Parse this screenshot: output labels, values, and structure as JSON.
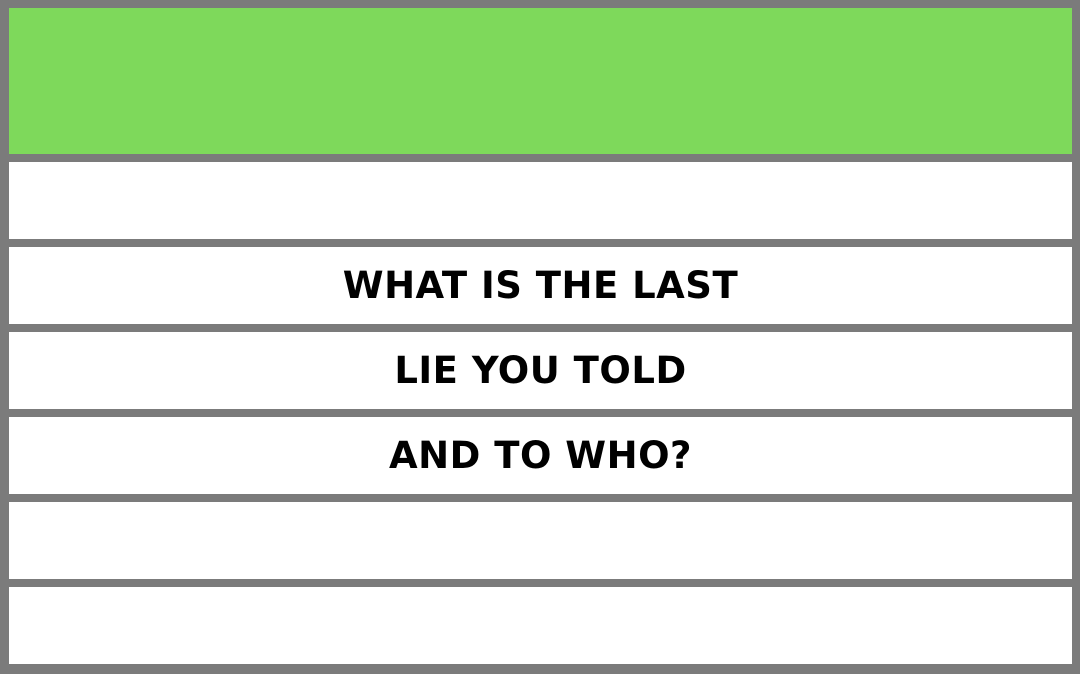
{
  "colors": {
    "frame": "#7b7b7b",
    "header": "#7ed95b",
    "row": "#ffffff",
    "text": "#000000"
  },
  "question": {
    "line1": "WHAT IS THE LAST",
    "line2": "LIE YOU TOLD",
    "line3": "AND TO WHO?"
  }
}
